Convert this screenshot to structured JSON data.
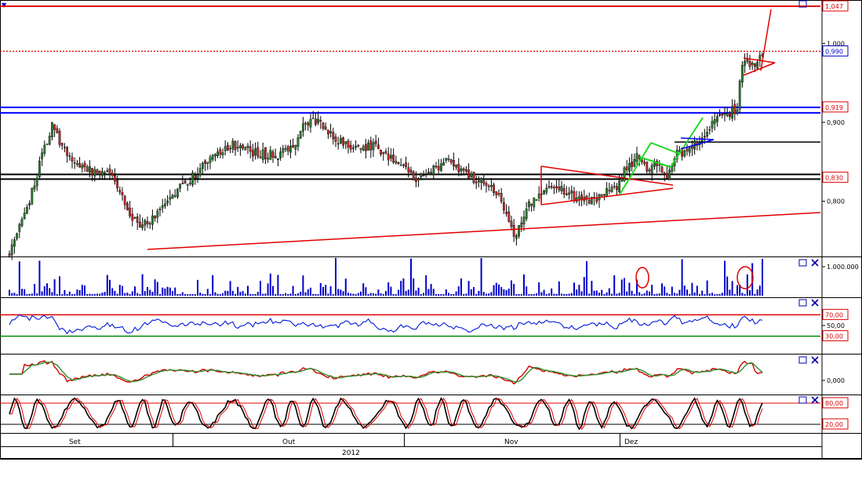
{
  "colors": {
    "up": "#2e7d32",
    "down": "#c62828",
    "candle_outline": "#000000",
    "trendline_red": "#e10000",
    "flag_green": "#1fd81f",
    "support_blue": "#0000ff",
    "support_black": "#000000",
    "volume": "#0000cc",
    "rsi_line": "#0018d8",
    "rsi_upper": "#e00000",
    "rsi_lower": "#008a00",
    "macd_a": "#d00000",
    "macd_b": "#2f8f2f",
    "stoch_k": "#000000",
    "stoch_d": "#e00000",
    "panel_border": "#0000aa"
  },
  "top_marker": "▼",
  "panel_icons": {
    "maximize": "maximize-icon",
    "close": "close-icon"
  },
  "price_panel": {
    "tick_labels": [
      "1,000",
      "0,900",
      "0,800"
    ],
    "price_tags": [
      {
        "label": "1,047",
        "value": 1.047,
        "color": "#e00000"
      },
      {
        "label": "0,990",
        "value": 0.99,
        "color": "#0000cc"
      },
      {
        "label": "0,919",
        "value": 0.919,
        "color": "#e00000"
      },
      {
        "label": "0,830",
        "value": 0.83,
        "color": "#e00000"
      }
    ]
  },
  "volume_panel": {
    "tick_labels": [
      "1.000.000"
    ]
  },
  "rsi_panel": {
    "tick_labels": [
      "50,00"
    ],
    "level_tags": [
      {
        "label": "70,00",
        "value": 70,
        "color": "#e00000"
      },
      {
        "label": "30,00",
        "value": 30,
        "color": "#e00000"
      }
    ]
  },
  "macd_panel": {
    "tick_labels": [
      "0,000"
    ]
  },
  "stoch_panel": {
    "level_tags": [
      {
        "label": "80,00",
        "value": 80,
        "color": "#e00000"
      },
      {
        "label": "20,00",
        "value": 20,
        "color": "#e00000"
      }
    ]
  },
  "x_axis": {
    "months": [
      "Set",
      "Out",
      "Nov",
      "Dez"
    ],
    "year": "2012"
  },
  "chart_data": [
    {
      "type": "candlestick",
      "title": "",
      "ylim": [
        0.73,
        1.055
      ],
      "period": [
        "2012-09",
        "2012-12"
      ],
      "price_path_anchors": [
        [
          0,
          0.735
        ],
        [
          5,
          0.775
        ],
        [
          10,
          0.82
        ],
        [
          13,
          0.86
        ],
        [
          17,
          0.895
        ],
        [
          20,
          0.875
        ],
        [
          24,
          0.855
        ],
        [
          28,
          0.845
        ],
        [
          34,
          0.838
        ],
        [
          40,
          0.832
        ],
        [
          44,
          0.815
        ],
        [
          48,
          0.785
        ],
        [
          52,
          0.77
        ],
        [
          56,
          0.775
        ],
        [
          60,
          0.79
        ],
        [
          64,
          0.808
        ],
        [
          70,
          0.82
        ],
        [
          76,
          0.842
        ],
        [
          82,
          0.862
        ],
        [
          88,
          0.872
        ],
        [
          94,
          0.865
        ],
        [
          100,
          0.86
        ],
        [
          106,
          0.858
        ],
        [
          110,
          0.863
        ],
        [
          114,
          0.87
        ],
        [
          117,
          0.895
        ],
        [
          120,
          0.9
        ],
        [
          124,
          0.898
        ],
        [
          128,
          0.885
        ],
        [
          134,
          0.87
        ],
        [
          140,
          0.865
        ],
        [
          146,
          0.872
        ],
        [
          150,
          0.858
        ],
        [
          156,
          0.845
        ],
        [
          162,
          0.826
        ],
        [
          168,
          0.838
        ],
        [
          174,
          0.85
        ],
        [
          180,
          0.838
        ],
        [
          186,
          0.828
        ],
        [
          192,
          0.82
        ],
        [
          196,
          0.8
        ],
        [
          200,
          0.762
        ],
        [
          202,
          0.758
        ],
        [
          206,
          0.79
        ],
        [
          212,
          0.815
        ],
        [
          218,
          0.822
        ],
        [
          222,
          0.808
        ],
        [
          228,
          0.805
        ],
        [
          234,
          0.8
        ],
        [
          238,
          0.812
        ],
        [
          242,
          0.818
        ],
        [
          246,
          0.843
        ],
        [
          250,
          0.855
        ],
        [
          254,
          0.842
        ],
        [
          258,
          0.85
        ],
        [
          262,
          0.83
        ],
        [
          266,
          0.86
        ],
        [
          270,
          0.865
        ],
        [
          274,
          0.875
        ],
        [
          278,
          0.89
        ],
        [
          282,
          0.905
        ],
        [
          286,
          0.91
        ],
        [
          288,
          0.915
        ],
        [
          290,
          0.918
        ],
        [
          291,
          0.95
        ],
        [
          292,
          0.975
        ],
        [
          294,
          0.98
        ],
        [
          296,
          0.972
        ],
        [
          298,
          0.978
        ],
        [
          300,
          0.99
        ]
      ],
      "support_lines": [
        {
          "color": "#0000ff",
          "level": 0.919
        },
        {
          "color": "#0000ff",
          "level": 0.912
        },
        {
          "color": "#000000",
          "level": 0.834
        },
        {
          "color": "#000000",
          "level": 0.828
        },
        {
          "color": "#e00000",
          "level": 1.047
        },
        {
          "color": "#e00000",
          "level": 0.99,
          "dotted": true
        }
      ]
    },
    {
      "type": "bar",
      "title": "",
      "ylim": [
        0,
        1000000
      ],
      "series": [
        {
          "values": []
        }
      ]
    },
    {
      "type": "line",
      "title": "",
      "ylim": [
        0,
        100
      ],
      "levels": [
        70,
        30
      ]
    },
    {
      "type": "line",
      "title": "",
      "levels": [
        0
      ]
    },
    {
      "type": "line",
      "title": "",
      "ylim": [
        0,
        100
      ],
      "levels": [
        80,
        20
      ]
    }
  ]
}
